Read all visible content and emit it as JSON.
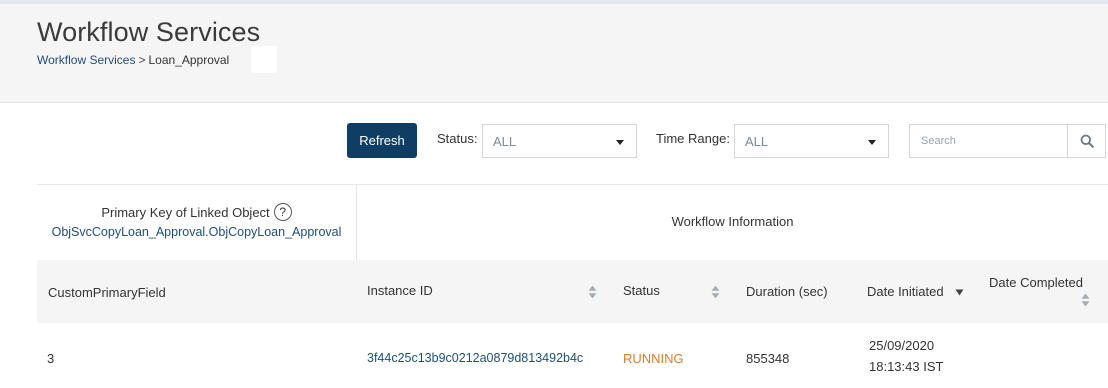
{
  "header": {
    "title": "Workflow Services",
    "breadcrumb": {
      "parent": "Workflow Services",
      "separator": ">",
      "current": "Loan_Approval"
    }
  },
  "toolbar": {
    "refresh_label": "Refresh",
    "status_label": "Status:",
    "status_value": "ALL",
    "time_range_label": "Time Range:",
    "time_range_value": "ALL",
    "search_placeholder": "Search"
  },
  "linked_object": {
    "title": "Primary Key of Linked Object",
    "help": "?",
    "value": "ObjSvcCopyLoan_Approval.ObjCopyLoan_Approval"
  },
  "workflow_info_label": "Workflow Information",
  "table": {
    "columns": {
      "custom_primary_field": "CustomPrimaryField",
      "instance_id": "Instance ID",
      "status": "Status",
      "duration": "Duration (sec)",
      "date_initiated": "Date Initiated",
      "date_completed": "Date Completed"
    },
    "rows": [
      {
        "custom_primary_field": "3",
        "instance_id": "3f44c25c13b9c0212a0879d813492b4c",
        "status": "RUNNING",
        "duration": "855348",
        "date_initiated_date": "25/09/2020",
        "date_initiated_time": "18:13:43 IST",
        "date_completed": ""
      }
    ]
  },
  "colors": {
    "primary_button": "#0f3d63",
    "link": "#1f4e79",
    "status_running": "#e07b2c",
    "header_bg": "#f5f5f5"
  },
  "icons": {
    "sort": "sort-updown-icon",
    "sort_desc": "sort-down-icon",
    "search": "search-icon",
    "help": "help-circle-icon",
    "dropdown": "chevron-down-icon"
  }
}
